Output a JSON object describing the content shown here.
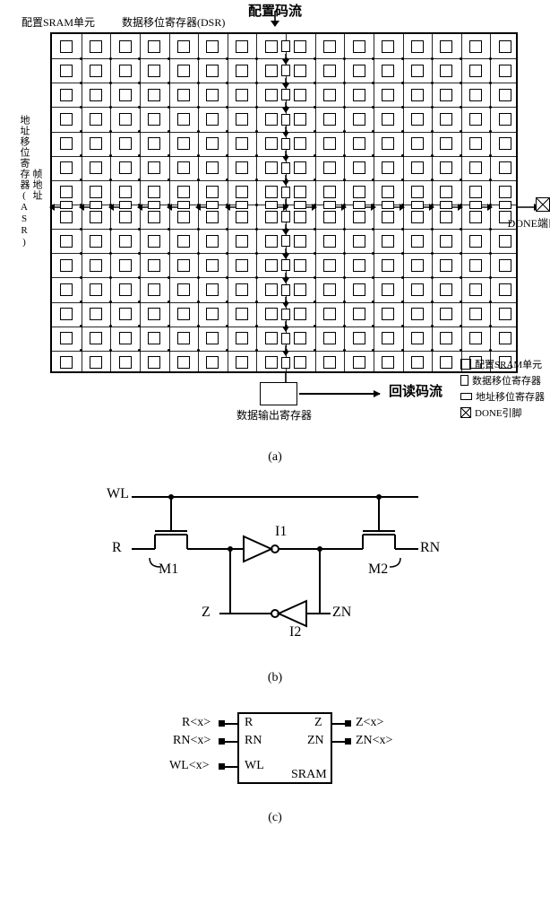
{
  "fig_a": {
    "title_top_center": "配置码流",
    "label_sram_cell": "配置SRAM单元",
    "label_dsr": "数据移位寄存器(DSR)",
    "label_asr_vert": "地址移位寄存器(ASR)",
    "label_frame_addr": "帧地址",
    "label_done_port": "DONE端口",
    "out_reg_label": "数据输出寄存器",
    "readback_label": "回读码流",
    "leader_cell": "配置SRAM单元",
    "legend": {
      "sram": "配置SRAM单元",
      "dsr": "数据移位寄存器",
      "asr": "地址移位寄存器",
      "done": "DONE引脚"
    },
    "sublabel": "(a)"
  },
  "fig_b": {
    "pins": {
      "WL": "WL",
      "R": "R",
      "RN": "RN",
      "Z": "Z",
      "ZN": "ZN"
    },
    "parts": {
      "M1": "M1",
      "M2": "M2",
      "I1": "I1",
      "I2": "I2"
    },
    "sublabel": "(b)"
  },
  "fig_c": {
    "inputs": {
      "R": "R<x>",
      "RN": "RN<x>",
      "WL": "WL<x>"
    },
    "outputs": {
      "Z": "Z<x>",
      "ZN": "ZN<x>"
    },
    "port_names": {
      "R": "R",
      "RN": "RN",
      "WL": "WL",
      "Z": "Z",
      "ZN": "ZN"
    },
    "block_name": "SRAM",
    "sublabel": "(c)"
  }
}
